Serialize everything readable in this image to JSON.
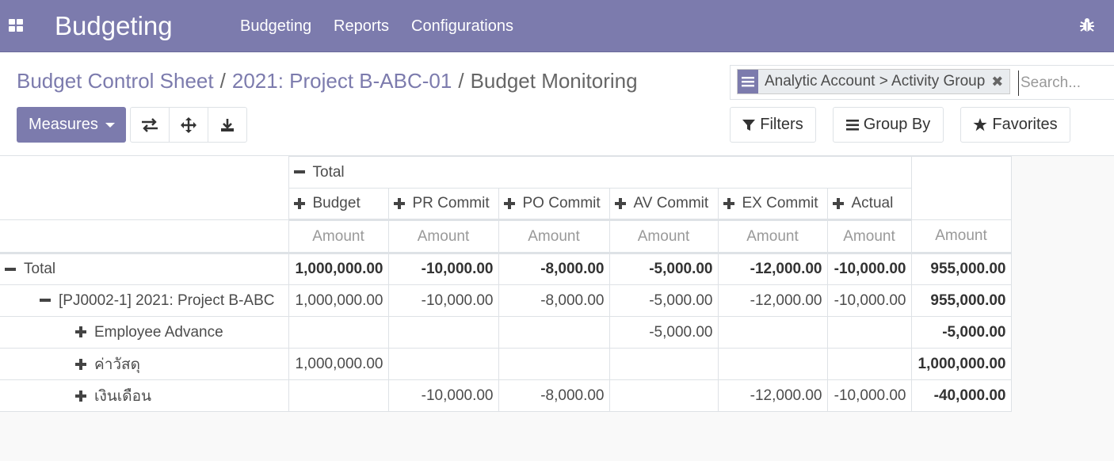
{
  "navbar": {
    "brand": "Budgeting",
    "menus": [
      "Budgeting",
      "Reports",
      "Configurations"
    ],
    "icons": {
      "apps": "apps-grid-icon",
      "debug": "bug-icon"
    }
  },
  "breadcrumb": {
    "items": [
      "Budget Control Sheet",
      "2021: Project B-ABC-01"
    ],
    "active": "Budget Monitoring",
    "separator": "/"
  },
  "toolbar": {
    "measures_label": "Measures",
    "icons": [
      "flip-axis-icon",
      "expand-all-icon",
      "download-icon"
    ]
  },
  "search": {
    "facet_label": "Analytic Account > Activity Group",
    "facet_icon": "group-by-list-icon",
    "placeholder": "Search...",
    "value": ""
  },
  "filters": {
    "filters_label": "Filters",
    "groupby_label": "Group By",
    "favorites_label": "Favorites"
  },
  "pivot": {
    "col_total_label": "Total",
    "columns": [
      "Budget",
      "PR Commit",
      "PO Commit",
      "AV Commit",
      "EX Commit",
      "Actual"
    ],
    "measure_label": "Amount",
    "rows": [
      {
        "label": "Total",
        "level": 0,
        "expanded": true,
        "values": [
          "1,000,000.00",
          "-10,000.00",
          "-8,000.00",
          "-5,000.00",
          "-12,000.00",
          "-10,000.00"
        ],
        "total": "955,000.00"
      },
      {
        "label": "[PJ0002-1] 2021: Project B-ABC",
        "level": 1,
        "expanded": true,
        "values": [
          "1,000,000.00",
          "-10,000.00",
          "-8,000.00",
          "-5,000.00",
          "-12,000.00",
          "-10,000.00"
        ],
        "total": "955,000.00"
      },
      {
        "label": "Employee Advance",
        "level": 2,
        "expanded": false,
        "values": [
          "",
          "",
          "",
          "-5,000.00",
          "",
          ""
        ],
        "total": "-5,000.00"
      },
      {
        "label": "ค่าวัสดุ",
        "level": 2,
        "expanded": false,
        "values": [
          "1,000,000.00",
          "",
          "",
          "",
          "",
          ""
        ],
        "total": "1,000,000.00"
      },
      {
        "label": "เงินเดือน",
        "level": 2,
        "expanded": false,
        "values": [
          "",
          "-10,000.00",
          "-8,000.00",
          "",
          "-12,000.00",
          "-10,000.00"
        ],
        "total": "-40,000.00"
      }
    ]
  },
  "colors": {
    "brand": "#7c7bad",
    "border": "#dee2e6",
    "muted": "#999999"
  }
}
